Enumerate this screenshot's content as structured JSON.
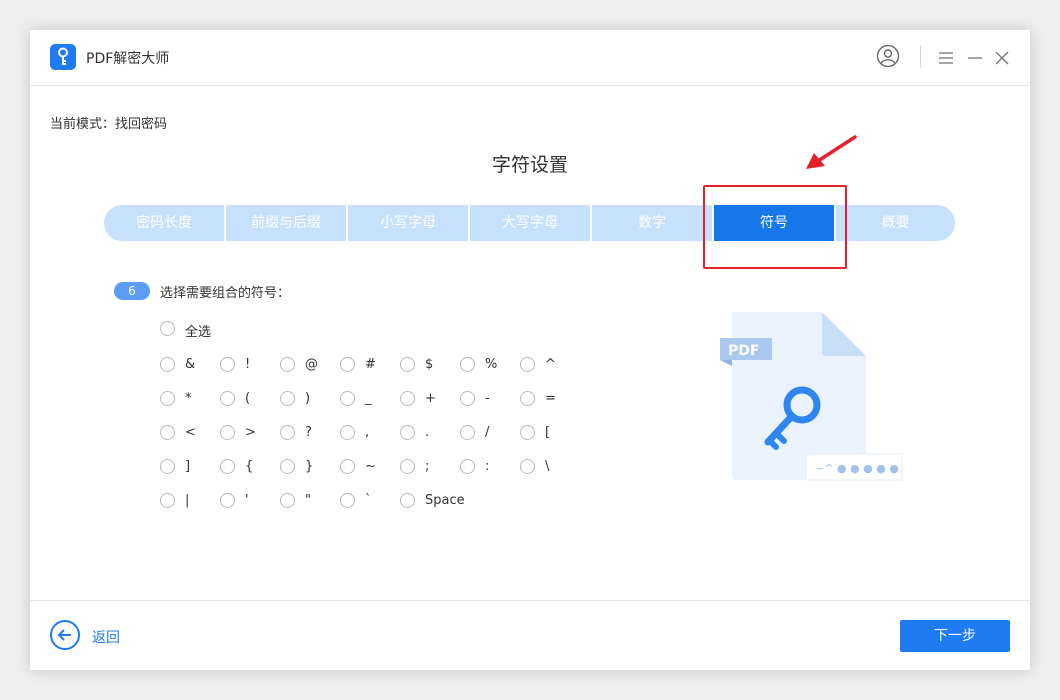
{
  "app": {
    "title": "PDF解密大师"
  },
  "mode": {
    "text": "当前模式：找回密码"
  },
  "heading": "字符设置",
  "steps": [
    {
      "label": "密码长度",
      "active": false
    },
    {
      "label": "前缀与后缀",
      "active": false
    },
    {
      "label": "小写字母",
      "active": false
    },
    {
      "label": "大写字母",
      "active": false
    },
    {
      "label": "数字",
      "active": false
    },
    {
      "label": "符号",
      "active": true
    },
    {
      "label": "概要",
      "active": false
    }
  ],
  "section": {
    "badge": "6",
    "prompt": "选择需要组合的符号："
  },
  "select_all": "全选",
  "symbols": [
    [
      "&",
      "!",
      "@",
      "#",
      "$",
      "%",
      "^"
    ],
    [
      "*",
      "(",
      ")",
      "_",
      "+",
      "-",
      "="
    ],
    [
      "<",
      ">",
      "?",
      ",",
      ".",
      "/",
      "["
    ],
    [
      "]",
      "{",
      "}",
      "~",
      ";",
      ":",
      "\\"
    ],
    [
      "|",
      "'",
      "\"",
      "`",
      "Space"
    ]
  ],
  "illustration": {
    "doc_label": "PDF",
    "password_hint": "~^ ● ● ● ● ●"
  },
  "footer": {
    "back_label": "返回",
    "next_label": "下一步"
  },
  "colors": {
    "accent": "#1f7bf2",
    "step_inactive": "#c7e0fb",
    "step_active": "#1577ea",
    "highlight": "#e8202a"
  }
}
